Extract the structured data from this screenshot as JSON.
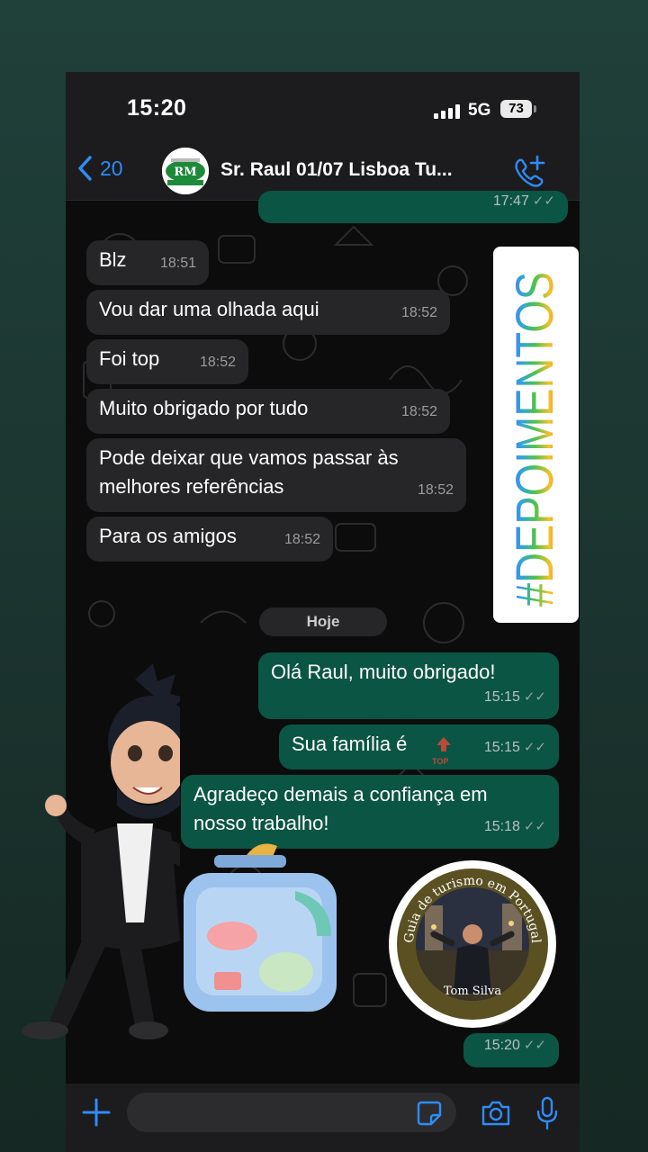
{
  "status": {
    "time": "15:20",
    "network": "5G",
    "battery": "73"
  },
  "header": {
    "back_count": "20",
    "title": "Sr. Raul 01/07 Lisboa Tu...",
    "avatar_text": "RM"
  },
  "messages": [
    {
      "dir": "out",
      "text": "",
      "time": "17:47",
      "read": true
    },
    {
      "dir": "in",
      "text": "Blz",
      "time": "18:51"
    },
    {
      "dir": "in",
      "text": "Vou dar uma olhada aqui",
      "time": "18:52"
    },
    {
      "dir": "in",
      "text": "Foi top",
      "time": "18:52"
    },
    {
      "dir": "in",
      "text": "Muito obrigado por tudo",
      "time": "18:52"
    },
    {
      "dir": "in",
      "text": "Pode deixar que vamos passar às melhores referências",
      "time": "18:52"
    },
    {
      "dir": "in",
      "text": "Para os amigos",
      "time": "18:52"
    },
    {
      "dir": "out",
      "text": "Olá Raul, muito obrigado!",
      "time": "15:15",
      "read": true
    },
    {
      "dir": "out",
      "text": "Sua família é",
      "time": "15:15",
      "read": true
    },
    {
      "dir": "out",
      "text": "Agradeço demais a confiança em nosso trabalho!",
      "time": "15:18",
      "read": true
    },
    {
      "dir": "out",
      "text": "",
      "time": "15:20",
      "read": true
    }
  ],
  "day_separator": "Hoje",
  "top_badge": "TOP",
  "stickers": {
    "hashtag": "#DEPOIMENTOS",
    "guide_arc": "Guia de turismo em Portugal",
    "guide_name": "Tom Silva"
  },
  "colors": {
    "incoming": "#262628",
    "outgoing": "#0b5544",
    "accent": "#2f8cf6"
  },
  "icons": [
    "chevron-left-icon",
    "phone-plus-icon",
    "plus-icon",
    "sticker-icon",
    "camera-icon",
    "microphone-icon"
  ]
}
